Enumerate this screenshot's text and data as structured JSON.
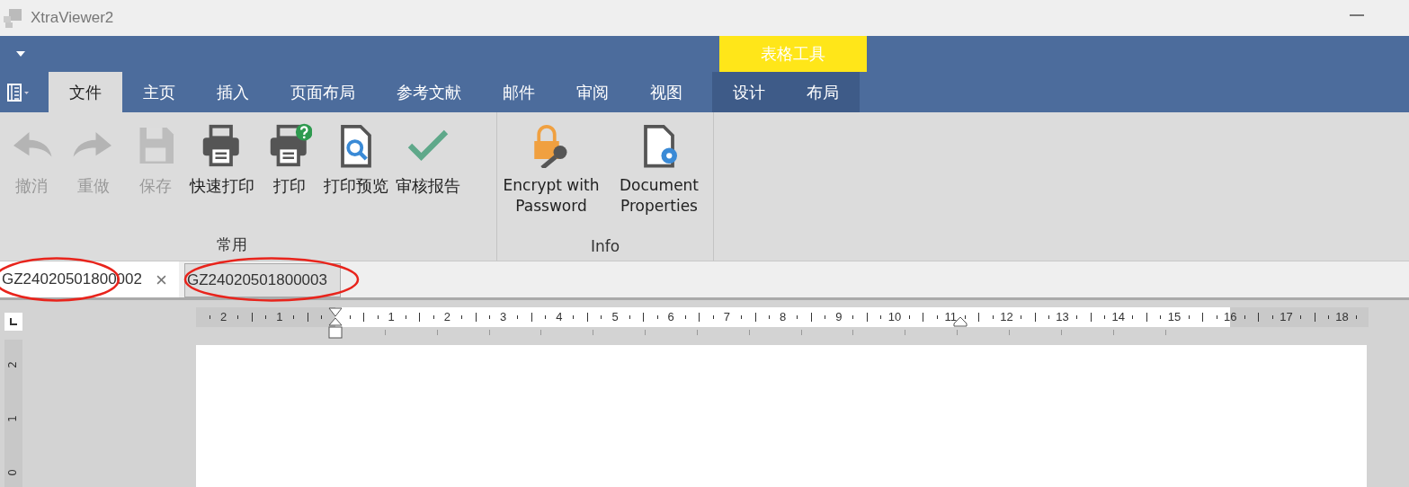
{
  "window": {
    "title": "XtraViewer2"
  },
  "context_group": {
    "label": "表格工具"
  },
  "tabs": [
    {
      "label": "文件",
      "selected": true,
      "contextual": false
    },
    {
      "label": "主页",
      "selected": false,
      "contextual": false
    },
    {
      "label": "插入",
      "selected": false,
      "contextual": false
    },
    {
      "label": "页面布局",
      "selected": false,
      "contextual": false
    },
    {
      "label": "参考文献",
      "selected": false,
      "contextual": false
    },
    {
      "label": "邮件",
      "selected": false,
      "contextual": false
    },
    {
      "label": "审阅",
      "selected": false,
      "contextual": false
    },
    {
      "label": "视图",
      "selected": false,
      "contextual": false
    },
    {
      "label": "设计",
      "selected": false,
      "contextual": true
    },
    {
      "label": "布局",
      "selected": false,
      "contextual": true
    }
  ],
  "groups": [
    {
      "label": "常用",
      "buttons": [
        {
          "kind": "undo",
          "label": "撤消",
          "disabled": true
        },
        {
          "kind": "redo",
          "label": "重做",
          "disabled": true
        },
        {
          "kind": "save",
          "label": "保存",
          "disabled": true
        },
        {
          "kind": "quickprint",
          "label": "快速打印",
          "disabled": false
        },
        {
          "kind": "print",
          "label": "打印",
          "disabled": false
        },
        {
          "kind": "preview",
          "label": "打印预览",
          "disabled": false
        },
        {
          "kind": "check",
          "label": "审核报告",
          "disabled": false
        }
      ]
    },
    {
      "label": "Info",
      "buttons": [
        {
          "kind": "encrypt",
          "label": "Encrypt with Password",
          "disabled": false
        },
        {
          "kind": "properties",
          "label": "Document Properties",
          "disabled": false
        }
      ]
    }
  ],
  "documents": [
    {
      "title": "GZ24020501800002",
      "selected": true,
      "closable": true,
      "circled": true
    },
    {
      "title": "GZ24020501800003",
      "selected": false,
      "closable": false,
      "circled": true
    }
  ],
  "ruler": {
    "labels": [
      "2",
      "1",
      "1",
      "2",
      "3",
      "4",
      "5",
      "6",
      "7",
      "8",
      "9",
      "10",
      "11",
      "12",
      "13",
      "14",
      "15",
      "16",
      "17",
      "18"
    ],
    "vertical_labels": [
      "2",
      "1",
      "0"
    ]
  }
}
